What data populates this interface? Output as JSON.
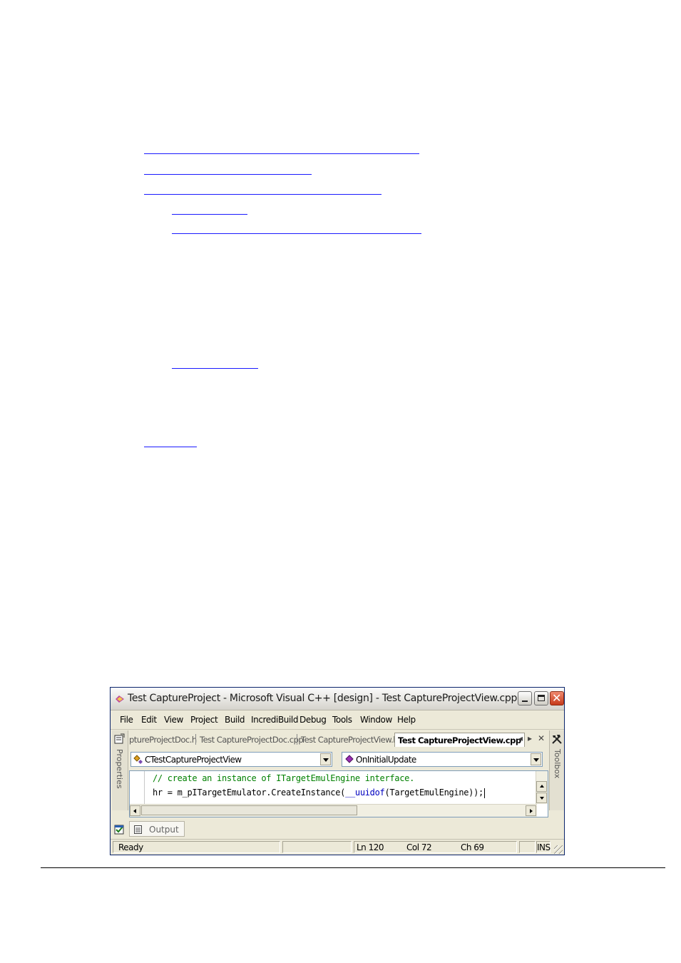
{
  "window": {
    "title": "Test CaptureProject - Microsoft Visual C++ [design] - Test CaptureProjectView.cpp"
  },
  "menu": [
    "File",
    "Edit",
    "View",
    "Project",
    "Build",
    "IncrediBuild",
    "Debug",
    "Tools",
    "Window",
    "Help"
  ],
  "side_panels": {
    "left": "Properties",
    "right": "Toolbox"
  },
  "tabs": [
    "ptureProjectDoc.h",
    "Test CaptureProjectDoc.cpp",
    "Test CaptureProjectView.h",
    "Test CaptureProjectView.cpp"
  ],
  "active_tab": "Test CaptureProjectView.cpp",
  "combos": {
    "class": "CTestCaptureProjectView",
    "member": "OnInitialUpdate"
  },
  "code": {
    "line1": "// create an instance of ITargetEmulEngine interface.",
    "line2_a": "hr = m_pITargetEmulator.CreateInstance(",
    "line2_kw": "__uuidof",
    "line2_b": "(TargetEmulEngine));"
  },
  "output_tab": "Output",
  "status": {
    "ready": "Ready",
    "ln": "Ln 120",
    "col": "Col 72",
    "ch": "Ch 69",
    "ins": "INS"
  },
  "colors": {
    "link_underline": "#1a1aff",
    "comment": "#008000",
    "keyword": "#0000c0",
    "title_border": "#0a246a"
  }
}
